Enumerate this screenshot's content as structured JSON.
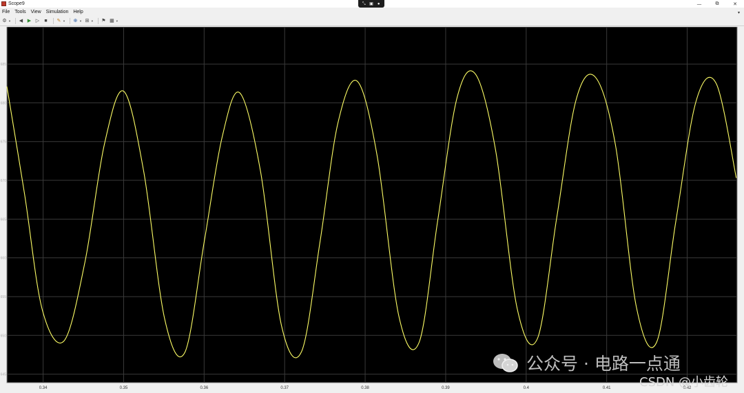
{
  "window": {
    "title": "Scope9",
    "controls": {
      "minimize": "—",
      "restore": "⧉",
      "close": "✕"
    }
  },
  "menu": {
    "items": [
      "File",
      "Tools",
      "View",
      "Simulation",
      "Help"
    ]
  },
  "toolbar": {
    "icons": [
      "settings-icon",
      "step-back-icon",
      "run-icon",
      "step-forward-icon",
      "stop-icon",
      "highlight-icon",
      "zoom-icon",
      "autoscale-icon",
      "trigger-icon",
      "measure-icon"
    ]
  },
  "colors": {
    "plot_bg": "#000000",
    "grid": "#3a3a3a",
    "trace": "#ffff66",
    "axis_text": "#b0b0b0"
  },
  "chart_data": {
    "type": "line",
    "title": "",
    "xlabel": "",
    "ylabel": "",
    "xlim": [
      0.3355,
      0.4262
    ],
    "ylim": [
      643.9,
      689.8
    ],
    "x_ticks": [
      0.34,
      0.35,
      0.36,
      0.37,
      0.38,
      0.39,
      0.4,
      0.41,
      0.42
    ],
    "y_ticks": [
      645,
      650,
      655,
      660,
      665,
      670,
      675,
      680,
      685
    ],
    "grid": true,
    "legend": "none",
    "series": [
      {
        "color": "#ffff66",
        "points": [
          [
            0.3355,
            682.1
          ],
          [
            0.3377,
            668.2
          ],
          [
            0.3399,
            653.3
          ],
          [
            0.3426,
            649.3
          ],
          [
            0.3452,
            659.5
          ],
          [
            0.3476,
            674.6
          ],
          [
            0.35,
            681.5
          ],
          [
            0.3525,
            671.1
          ],
          [
            0.3551,
            652.1
          ],
          [
            0.3576,
            647.8
          ],
          [
            0.36,
            662.0
          ],
          [
            0.3622,
            675.4
          ],
          [
            0.3644,
            681.3
          ],
          [
            0.367,
            671.2
          ],
          [
            0.3696,
            651.3
          ],
          [
            0.3721,
            647.9
          ],
          [
            0.3744,
            662.1
          ],
          [
            0.3766,
            677.3
          ],
          [
            0.379,
            682.8
          ],
          [
            0.3815,
            673.1
          ],
          [
            0.3842,
            652.4
          ],
          [
            0.3867,
            649.1
          ],
          [
            0.389,
            664.7
          ],
          [
            0.3914,
            680.6
          ],
          [
            0.3937,
            683.7
          ],
          [
            0.3962,
            673.9
          ],
          [
            0.3989,
            653.4
          ],
          [
            0.4014,
            649.6
          ],
          [
            0.4038,
            665.2
          ],
          [
            0.4062,
            680.4
          ],
          [
            0.4086,
            683.3
          ],
          [
            0.4111,
            674.5
          ],
          [
            0.4137,
            653.6
          ],
          [
            0.4162,
            649.1
          ],
          [
            0.4186,
            664.8
          ],
          [
            0.4211,
            680.2
          ],
          [
            0.4236,
            682.5
          ],
          [
            0.4261,
            670.3
          ]
        ]
      }
    ]
  },
  "watermark": {
    "line1": "公众号 · 电路一点通",
    "line2": "CSDN @小齿轮"
  }
}
